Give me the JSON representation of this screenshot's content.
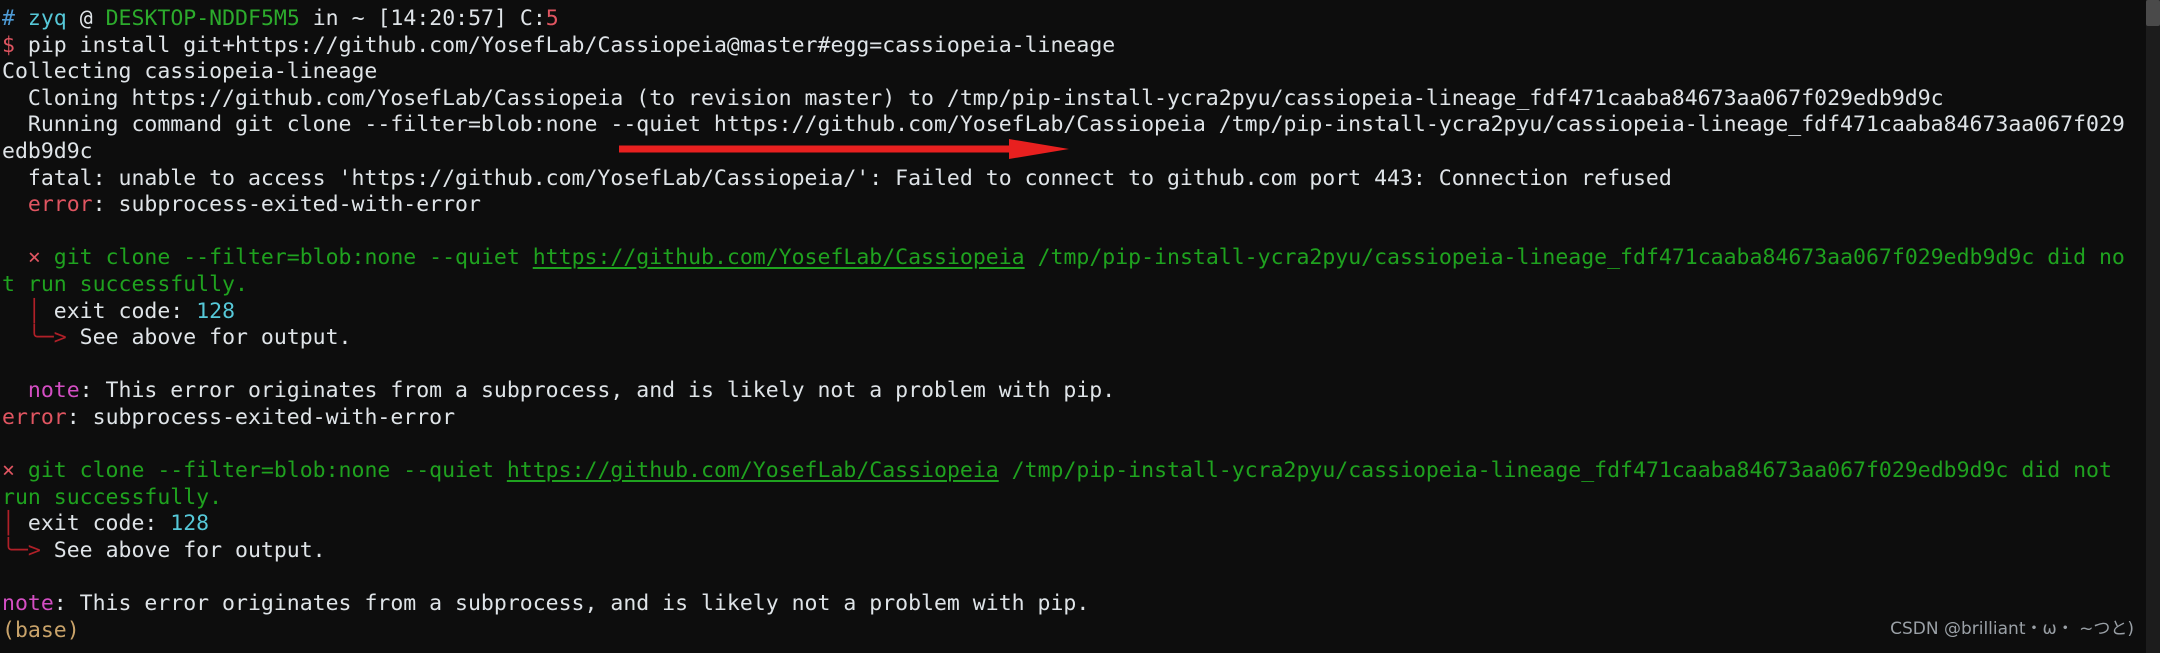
{
  "terminal": {
    "title": "Terminal",
    "background_color": "#0d0d0d",
    "foreground_color": "#d6dbe0",
    "prompt": {
      "symbol": "#",
      "user": "zyq",
      "at": "@",
      "host": "DESKTOP-NDDF5M5",
      "in": "in",
      "cwd": "~",
      "time": "[14:20:57]",
      "exit_label": "C:",
      "exit_code": "5"
    },
    "command_prompt_symbol": "$",
    "command": "pip install git+https://github.com/YosefLab/Cassiopeia@master#egg=cassiopeia-lineage",
    "conda_env": "(base)"
  },
  "output_lines": [
    {
      "id": "collecting",
      "segments": [
        {
          "text": "Collecting cassiopeia-lineage",
          "color": "white"
        }
      ]
    },
    {
      "id": "cloning",
      "segments": [
        {
          "text": "  Cloning https://github.com/YosefLab/Cassiopeia (to revision master) to /tmp/pip-install-ycra2pyu/cassiopeia-lineage_fdf471caaba84673aa067f029edb9d9c",
          "color": "white"
        }
      ]
    },
    {
      "id": "running-command",
      "segments": [
        {
          "text": "  Running command git clone --filter=blob:none --quiet https://github.com/YosefLab/Cassiopeia /tmp/pip-install-ycra2pyu/cassiopeia-lineage_fdf471caaba84673aa067f029",
          "color": "white"
        }
      ]
    },
    {
      "id": "cloning-wrap",
      "segments": [
        {
          "text": "edb9d9c",
          "color": "white"
        }
      ]
    },
    {
      "id": "fatal",
      "segments": [
        {
          "text": "  fatal: unable to access 'https://github.com/YosefLab/Cassiopeia/': Failed to connect to github.com port 443: Connection refused",
          "color": "white"
        }
      ]
    },
    {
      "id": "error-1",
      "segments": [
        {
          "text": "  ",
          "color": "white"
        },
        {
          "text": "error",
          "color": "red"
        },
        {
          "text": ": subprocess-exited-with-error",
          "color": "white"
        }
      ]
    }
  ],
  "error_block_1": {
    "marker": "×",
    "line1_pre": " git clone --filter=blob:none --quiet ",
    "url": "https://github.com/YosefLab/Cassiopeia",
    "line1_post": " /tmp/pip-install-ycra2pyu/cassiopeia-lineage_fdf471caaba84673aa067f029edb9d9c did no",
    "line1_wrap": "t run successfully.",
    "exit_bar": "│",
    "exit_label": " exit code: ",
    "exit_code": "128",
    "see_arrow": "╰─>",
    "see_text": " See above for output."
  },
  "note_1": {
    "label": "note",
    "text": ": This error originates from a subprocess, and is likely not a problem with pip."
  },
  "error_2": {
    "label": "error",
    "text": ": subprocess-exited-with-error"
  },
  "error_block_2": {
    "marker": "×",
    "line1_pre": " git clone --filter=blob:none --quiet ",
    "url": "https://github.com/YosefLab/Cassiopeia",
    "line1_post": " /tmp/pip-install-ycra2pyu/cassiopeia-lineage_fdf471caaba84673aa067f029edb9d9c did not",
    "line1_wrap": "run successfully.",
    "exit_bar": "│",
    "exit_label": " exit code: ",
    "exit_code": "128",
    "see_arrow": "╰─>",
    "see_text": " See above for output."
  },
  "note_2": {
    "label": "note",
    "text": ": This error originates from a subprocess, and is likely not a problem with pip."
  },
  "annotation": {
    "type": "red-arrow",
    "color": "#e8201f",
    "points_to": "Connection refused"
  },
  "watermark": {
    "text": "CSDN @brilliant・ω・ ~つと)"
  },
  "scrollbar": {
    "position": "right",
    "thumb_color": "#4a4a4a"
  }
}
